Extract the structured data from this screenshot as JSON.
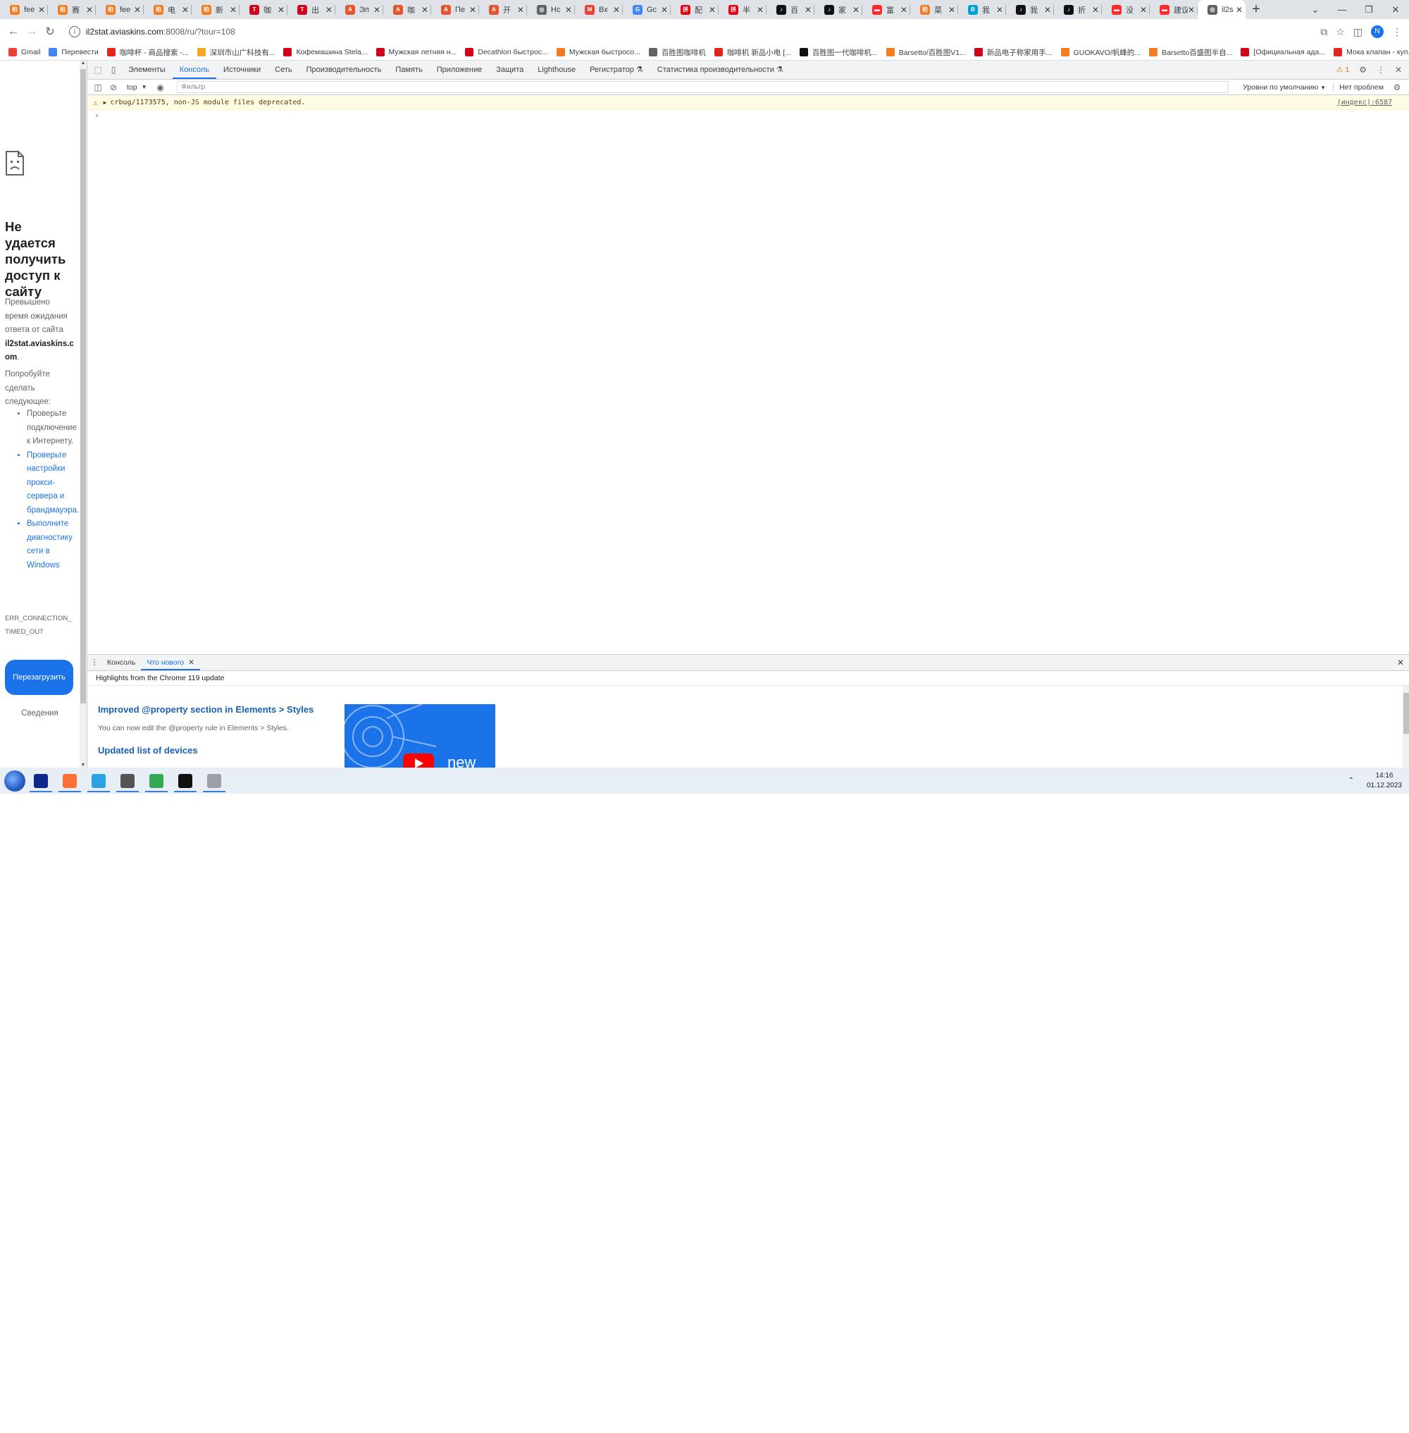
{
  "browser": {
    "tabs": [
      {
        "title": "fee",
        "favicon_color": "#f47b20",
        "favicon_glyph": "拍"
      },
      {
        "title": "赛",
        "favicon_color": "#f47b20",
        "favicon_glyph": "拍"
      },
      {
        "title": "fee",
        "favicon_color": "#f47b20",
        "favicon_glyph": "拍"
      },
      {
        "title": "电",
        "favicon_color": "#f47b20",
        "favicon_glyph": "拍"
      },
      {
        "title": "新",
        "favicon_color": "#f47b20",
        "favicon_glyph": "拍"
      },
      {
        "title": "咖",
        "favicon_color": "#d0021b",
        "favicon_glyph": "T"
      },
      {
        "title": "出",
        "favicon_color": "#d0021b",
        "favicon_glyph": "T"
      },
      {
        "title": "Эл",
        "favicon_color": "#e4572e",
        "favicon_glyph": "A"
      },
      {
        "title": "咖",
        "favicon_color": "#e4572e",
        "favicon_glyph": "A"
      },
      {
        "title": "Пе",
        "favicon_color": "#e4572e",
        "favicon_glyph": "A"
      },
      {
        "title": "开",
        "favicon_color": "#e4572e",
        "favicon_glyph": "A"
      },
      {
        "title": "Hc",
        "favicon_color": "#5f6368",
        "favicon_glyph": "◎"
      },
      {
        "title": "Вх",
        "favicon_color": "#ea4335",
        "favicon_glyph": "M"
      },
      {
        "title": "Gc",
        "favicon_color": "#4285f4",
        "favicon_glyph": "G"
      },
      {
        "title": "配",
        "favicon_color": "#e60012",
        "favicon_glyph": "拼"
      },
      {
        "title": "半",
        "favicon_color": "#e60012",
        "favicon_glyph": "拼"
      },
      {
        "title": "百",
        "favicon_color": "#111111",
        "favicon_glyph": "♪"
      },
      {
        "title": "家",
        "favicon_color": "#111111",
        "favicon_glyph": "♪"
      },
      {
        "title": "富",
        "favicon_color": "#ff2a2a",
        "favicon_glyph": "▬"
      },
      {
        "title": "菜",
        "favicon_color": "#f47b20",
        "favicon_glyph": "拍"
      },
      {
        "title": "我",
        "favicon_color": "#00a1d6",
        "favicon_glyph": "B"
      },
      {
        "title": "我",
        "favicon_color": "#111111",
        "favicon_glyph": "♪"
      },
      {
        "title": "折",
        "favicon_color": "#111111",
        "favicon_glyph": "♪"
      },
      {
        "title": "没",
        "favicon_color": "#ff2a2a",
        "favicon_glyph": "▬"
      },
      {
        "title": "建议",
        "favicon_color": "#ff2a2a",
        "favicon_glyph": "▬"
      },
      {
        "title": "il2s",
        "favicon_color": "#5f6368",
        "favicon_glyph": "◎",
        "active": true
      }
    ],
    "new_tab_glyph": "+",
    "window_controls": [
      "⌄",
      "—",
      "❐",
      "✕"
    ],
    "url_host": "il2stat.aviaskins.com",
    "url_rest": ":8008/ru/?tour=108",
    "avatar_letter": "N"
  },
  "bookmarks": [
    {
      "label": "Gmail",
      "color": "#ea4335"
    },
    {
      "label": "Перевести",
      "color": "#4285f4"
    },
    {
      "label": "咖啡杯 - 商品搜索 -...",
      "color": "#e1251b"
    },
    {
      "label": "深圳市山广科技有...",
      "color": "#f5a623"
    },
    {
      "label": "Кофемашина Stela...",
      "color": "#d0021b"
    },
    {
      "label": "Мужская летняя н...",
      "color": "#d0021b"
    },
    {
      "label": "Decathlon быстрос...",
      "color": "#d0021b"
    },
    {
      "label": "Мужская быстросо...",
      "color": "#f47b20"
    },
    {
      "label": "百胜图咖啡机",
      "color": "#5f6368"
    },
    {
      "label": "咖啡机 新品小电 [...",
      "color": "#e1251b"
    },
    {
      "label": "百胜图一代咖啡机...",
      "color": "#111111"
    },
    {
      "label": "Barsetto/百胜图V1...",
      "color": "#f47b20"
    },
    {
      "label": "新品电子称家用手...",
      "color": "#d0021b"
    },
    {
      "label": "GUOKAVO/帆峰的...",
      "color": "#f47b20"
    },
    {
      "label": "Barsetto百盛图半自...",
      "color": "#f47b20"
    },
    {
      "label": "[Официальная ада...",
      "color": "#d0021b"
    },
    {
      "label": "Мока клапан - куп...",
      "color": "#e52521"
    }
  ],
  "bookmarks_more": "»",
  "error_page": {
    "title": "Не удается получить доступ к сайту",
    "desc_prefix": "Превышено время ожидания ответа от сайта ",
    "desc_host": "il2stat.aviaskins.com",
    "desc_suffix": ".",
    "try_text": "Попробуйте сделать следующее:",
    "suggestions": [
      "Проверьте подключение к Интернету.",
      "Проверьте настройки прокси-сервера и брандмауэра.",
      "Выполните диагностику сети в Windows"
    ],
    "error_code": "ERR_CONNECTION_TIMED_OUT",
    "reload_label": "Перезагрузить",
    "details_label": "Сведения"
  },
  "devtools": {
    "tabs": [
      {
        "label": "Элементы"
      },
      {
        "label": "Консоль",
        "active": true
      },
      {
        "label": "Источники"
      },
      {
        "label": "Сеть"
      },
      {
        "label": "Производительность"
      },
      {
        "label": "Память"
      },
      {
        "label": "Приложение"
      },
      {
        "label": "Защита"
      },
      {
        "label": "Lighthouse"
      },
      {
        "label": "Регистратор ⚗"
      },
      {
        "label": "Статистика производительности ⚗"
      }
    ],
    "warnings_count": "1",
    "context": "top",
    "filter_placeholder": "Фильтр",
    "levels_label": "Уровни по умолчанию",
    "issues_label": "Нет проблем",
    "console_message": "crbug/1173575, non-JS module files deprecated.",
    "console_source": "(индекс):6587",
    "prompt_glyph": "›",
    "drawer": {
      "tabs": [
        {
          "label": "Консоль"
        },
        {
          "label": "Что нового",
          "active": true,
          "closable": true
        }
      ],
      "whats_new_header": "Highlights from the Chrome 119 update",
      "heading1": "Improved @property section in Elements > Styles",
      "paragraph1": "You can now edit the @property rule in Elements > Styles.",
      "heading2": "Updated list of devices",
      "video_text": "new"
    }
  },
  "taskbar": {
    "apps": [
      {
        "name": "intellij-idea",
        "color": "#0b2a8a"
      },
      {
        "name": "firefox",
        "color": "#ff7139"
      },
      {
        "name": "telegram",
        "color": "#2aa3e0"
      },
      {
        "name": "joystick",
        "color": "#555555"
      },
      {
        "name": "chrome",
        "color": "#34a853"
      },
      {
        "name": "terminal",
        "color": "#111111"
      },
      {
        "name": "gradle",
        "color": "#9aa0a6"
      }
    ],
    "time": "14:16",
    "date": "01.12.2023"
  }
}
